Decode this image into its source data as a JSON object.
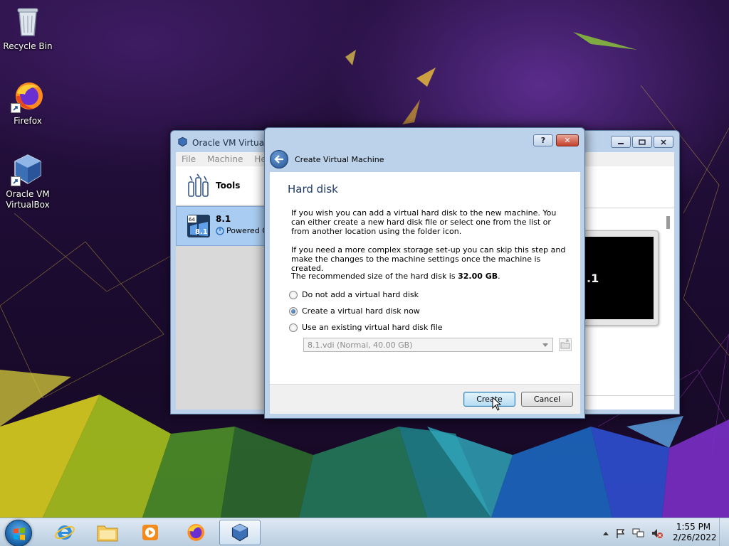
{
  "desktop": {
    "icons": [
      {
        "label": "Recycle Bin"
      },
      {
        "label": "Firefox"
      },
      {
        "label": "Oracle VM VirtualBox"
      }
    ]
  },
  "vbox_manager": {
    "title": "Oracle VM VirtualBo",
    "menu": [
      "File",
      "Machine",
      "Hel"
    ],
    "tools_label": "Tools",
    "vm": {
      "name": "8.1",
      "state": "Powered O",
      "badge_top": "64",
      "badge_bottom": "8.1"
    },
    "preview_text": ".1"
  },
  "wizard": {
    "title": "Create Virtual Machine",
    "help_label": "?",
    "close_label": "✕",
    "heading": "Hard disk",
    "para1": "If you wish you can add a virtual hard disk to the new machine. You can either create a new hard disk file or select one from the list or from another location using the folder icon.",
    "para2": "If you need a more complex storage set-up you can skip this step and make the changes to the machine settings once the machine is created.",
    "para3_prefix": "The recommended size of the hard disk is ",
    "para3_size": "32.00 GB",
    "para3_suffix": ".",
    "options": [
      {
        "label": "Do not add a virtual hard disk",
        "checked": false
      },
      {
        "label": "Create a virtual hard disk now",
        "checked": true
      },
      {
        "label": "Use an existing virtual hard disk file",
        "checked": false
      }
    ],
    "existing_disk": "8.1.vdi (Normal, 40.00 GB)",
    "create_label": "Create",
    "cancel_label": "Cancel"
  },
  "taskbar": {
    "time": "1:55 PM",
    "date": "2/26/2022"
  }
}
